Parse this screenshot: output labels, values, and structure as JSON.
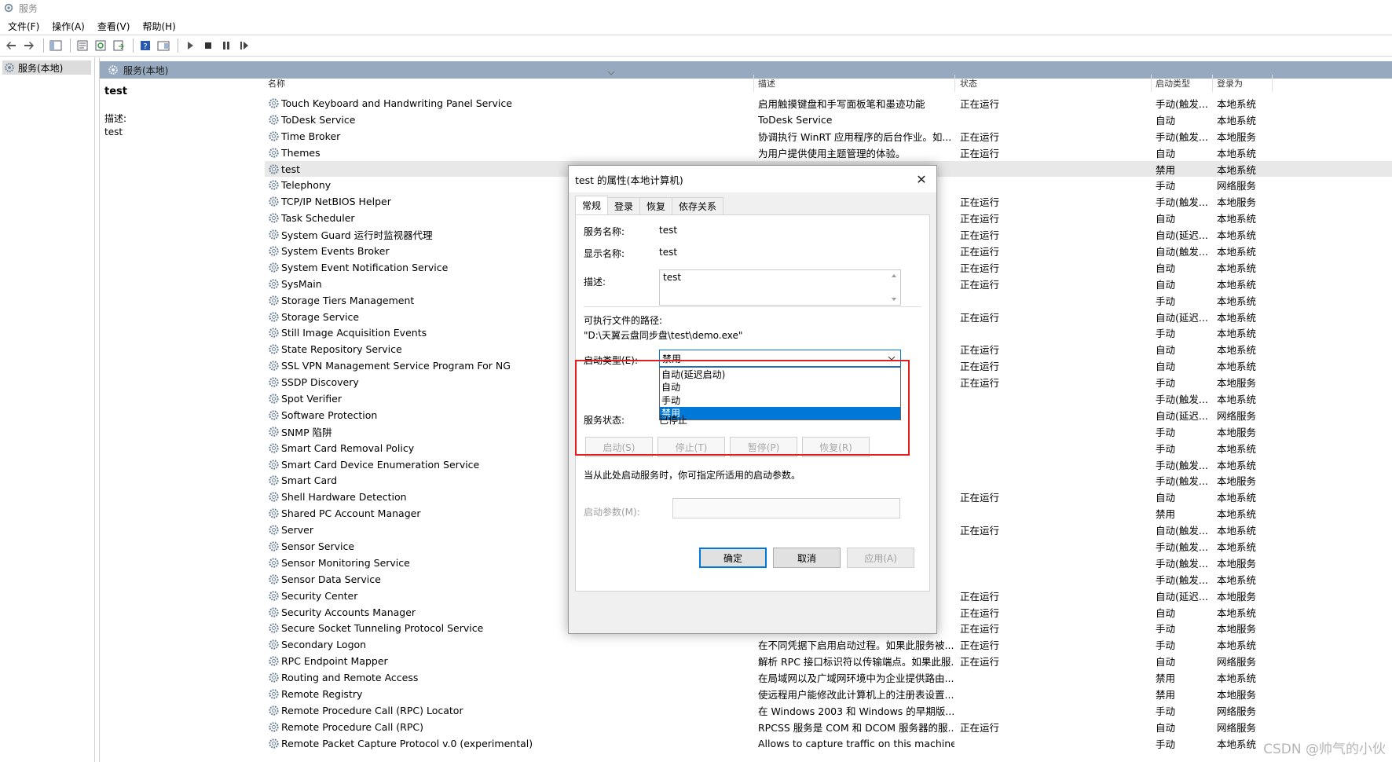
{
  "window": {
    "title": "服务"
  },
  "menu": [
    "文件(F)",
    "操作(A)",
    "查看(V)",
    "帮助(H)"
  ],
  "tree": {
    "item": "服务(本地)"
  },
  "main": {
    "header": "服务(本地)",
    "selected_name": "test",
    "desc_label": "描述:",
    "desc_value": "test"
  },
  "columns": {
    "name": "名称",
    "desc": "描述",
    "status": "状态",
    "start": "启动类型",
    "logon": "登录为"
  },
  "rows": [
    {
      "name": "Touch Keyboard and Handwriting Panel Service",
      "desc": "启用触摸键盘和手写面板笔和墨迹功能",
      "status": "正在运行",
      "start": "手动(触发...",
      "logon": "本地系统"
    },
    {
      "name": "ToDesk Service",
      "desc": "ToDesk Service",
      "status": "",
      "start": "自动",
      "logon": "本地系统"
    },
    {
      "name": "Time Broker",
      "desc": "协调执行 WinRT 应用程序的后台作业。如...",
      "status": "正在运行",
      "start": "手动(触发...",
      "logon": "本地服务"
    },
    {
      "name": "Themes",
      "desc": "为用户提供使用主题管理的体验。",
      "status": "正在运行",
      "start": "自动",
      "logon": "本地系统"
    },
    {
      "name": "test",
      "desc": "",
      "status": "",
      "start": "禁用",
      "logon": "本地系统"
    },
    {
      "name": "Telephony",
      "desc": "",
      "status": "",
      "start": "手动",
      "logon": "网络服务"
    },
    {
      "name": "TCP/IP NetBIOS Helper",
      "desc": "",
      "status": "正在运行",
      "start": "手动(触发...",
      "logon": "本地服务"
    },
    {
      "name": "Task Scheduler",
      "desc": "",
      "status": "正在运行",
      "start": "自动",
      "logon": "本地系统"
    },
    {
      "name": "System Guard 运行时监视器代理",
      "desc": "",
      "status": "正在运行",
      "start": "自动(延迟...",
      "logon": "本地系统"
    },
    {
      "name": "System Events Broker",
      "desc": "",
      "status": "正在运行",
      "start": "自动(触发...",
      "logon": "本地系统"
    },
    {
      "name": "System Event Notification Service",
      "desc": "",
      "status": "正在运行",
      "start": "自动",
      "logon": "本地系统"
    },
    {
      "name": "SysMain",
      "desc": "",
      "status": "正在运行",
      "start": "自动",
      "logon": "本地系统"
    },
    {
      "name": "Storage Tiers Management",
      "desc": "",
      "status": "",
      "start": "手动",
      "logon": "本地系统"
    },
    {
      "name": "Storage Service",
      "desc": "",
      "status": "正在运行",
      "start": "自动(延迟...",
      "logon": "本地系统"
    },
    {
      "name": "Still Image Acquisition Events",
      "desc": "",
      "status": "",
      "start": "手动",
      "logon": "本地系统"
    },
    {
      "name": "State Repository Service",
      "desc": "",
      "status": "正在运行",
      "start": "自动",
      "logon": "本地系统"
    },
    {
      "name": "SSL VPN Management Service Program For NG",
      "desc": "",
      "status": "正在运行",
      "start": "自动",
      "logon": "本地系统"
    },
    {
      "name": "SSDP Discovery",
      "desc": "",
      "status": "正在运行",
      "start": "手动",
      "logon": "本地服务"
    },
    {
      "name": "Spot Verifier",
      "desc": "",
      "status": "",
      "start": "手动(触发...",
      "logon": "本地系统"
    },
    {
      "name": "Software Protection",
      "desc": "",
      "status": "",
      "start": "自动(延迟...",
      "logon": "网络服务"
    },
    {
      "name": "SNMP 陷阱",
      "desc": "",
      "status": "",
      "start": "手动",
      "logon": "本地服务"
    },
    {
      "name": "Smart Card Removal Policy",
      "desc": "",
      "status": "",
      "start": "手动",
      "logon": "本地系统"
    },
    {
      "name": "Smart Card Device Enumeration Service",
      "desc": "",
      "status": "",
      "start": "手动(触发...",
      "logon": "本地系统"
    },
    {
      "name": "Smart Card",
      "desc": "",
      "status": "",
      "start": "手动(触发...",
      "logon": "本地服务"
    },
    {
      "name": "Shell Hardware Detection",
      "desc": "",
      "status": "正在运行",
      "start": "自动",
      "logon": "本地系统"
    },
    {
      "name": "Shared PC Account Manager",
      "desc": "",
      "status": "",
      "start": "禁用",
      "logon": "本地系统"
    },
    {
      "name": "Server",
      "desc": "",
      "status": "正在运行",
      "start": "自动(触发...",
      "logon": "本地系统"
    },
    {
      "name": "Sensor Service",
      "desc": "",
      "status": "",
      "start": "手动(触发...",
      "logon": "本地系统"
    },
    {
      "name": "Sensor Monitoring Service",
      "desc": "",
      "status": "",
      "start": "手动(触发...",
      "logon": "本地服务"
    },
    {
      "name": "Sensor Data Service",
      "desc": "",
      "status": "",
      "start": "手动(触发...",
      "logon": "本地系统"
    },
    {
      "name": "Security Center",
      "desc": "",
      "status": "正在运行",
      "start": "自动(延迟...",
      "logon": "本地服务"
    },
    {
      "name": "Security Accounts Manager",
      "desc": "",
      "status": "正在运行",
      "start": "自动",
      "logon": "本地系统"
    },
    {
      "name": "Secure Socket Tunneling Protocol Service",
      "desc": "",
      "status": "正在运行",
      "start": "手动",
      "logon": "本地服务"
    },
    {
      "name": "Secondary Logon",
      "desc": "在不同凭据下启用启动过程。如果此服务被...",
      "status": "正在运行",
      "start": "手动",
      "logon": "本地系统"
    },
    {
      "name": "RPC Endpoint Mapper",
      "desc": "解析 RPC 接口标识符以传输端点。如果此服...",
      "status": "正在运行",
      "start": "自动",
      "logon": "网络服务"
    },
    {
      "name": "Routing and Remote Access",
      "desc": "在局域网以及广域网环境中为企业提供路由...",
      "status": "",
      "start": "禁用",
      "logon": "本地系统"
    },
    {
      "name": "Remote Registry",
      "desc": "使远程用户能修改此计算机上的注册表设置...",
      "status": "",
      "start": "禁用",
      "logon": "本地服务"
    },
    {
      "name": "Remote Procedure Call (RPC) Locator",
      "desc": "在 Windows 2003 和 Windows 的早期版...",
      "status": "",
      "start": "手动",
      "logon": "网络服务"
    },
    {
      "name": "Remote Procedure Call (RPC)",
      "desc": "RPCSS 服务是 COM 和 DCOM 服务器的服...",
      "status": "正在运行",
      "start": "自动",
      "logon": "网络服务"
    },
    {
      "name": "Remote Packet Capture Protocol v.0 (experimental)",
      "desc": "Allows to capture traffic on this machine...",
      "status": "",
      "start": "手动",
      "logon": "本地系统"
    }
  ],
  "dialog": {
    "title": "test 的属性(本地计算机)",
    "close": "✕",
    "tabs": [
      "常规",
      "登录",
      "恢复",
      "依存关系"
    ],
    "service_name_label": "服务名称:",
    "service_name": "test",
    "display_name_label": "显示名称:",
    "display_name": "test",
    "desc_label": "描述:",
    "desc_value": "test",
    "path_label": "可执行文件的路径:",
    "path_value": "\"D:\\天翼云盘同步盘\\test\\demo.exe\"",
    "startup_label": "启动类型(E):",
    "startup_value": "禁用",
    "startup_options": [
      "自动(延迟启动)",
      "自动",
      "手动",
      "禁用"
    ],
    "status_label": "服务状态:",
    "status_value": "已停止",
    "buttons": {
      "start": "启动(S)",
      "stop": "停止(T)",
      "pause": "暂停(P)",
      "resume": "恢复(R)"
    },
    "hint": "当从此处启动服务时，你可指定所适用的启动参数。",
    "param_label": "启动参数(M):",
    "ok": "确定",
    "cancel": "取消",
    "apply": "应用(A)"
  },
  "watermark": "CSDN @帅气的小伙",
  "colors": {
    "header_bar": "#97a9be",
    "accent": "#0078d7",
    "highlight": "#e0201c"
  }
}
